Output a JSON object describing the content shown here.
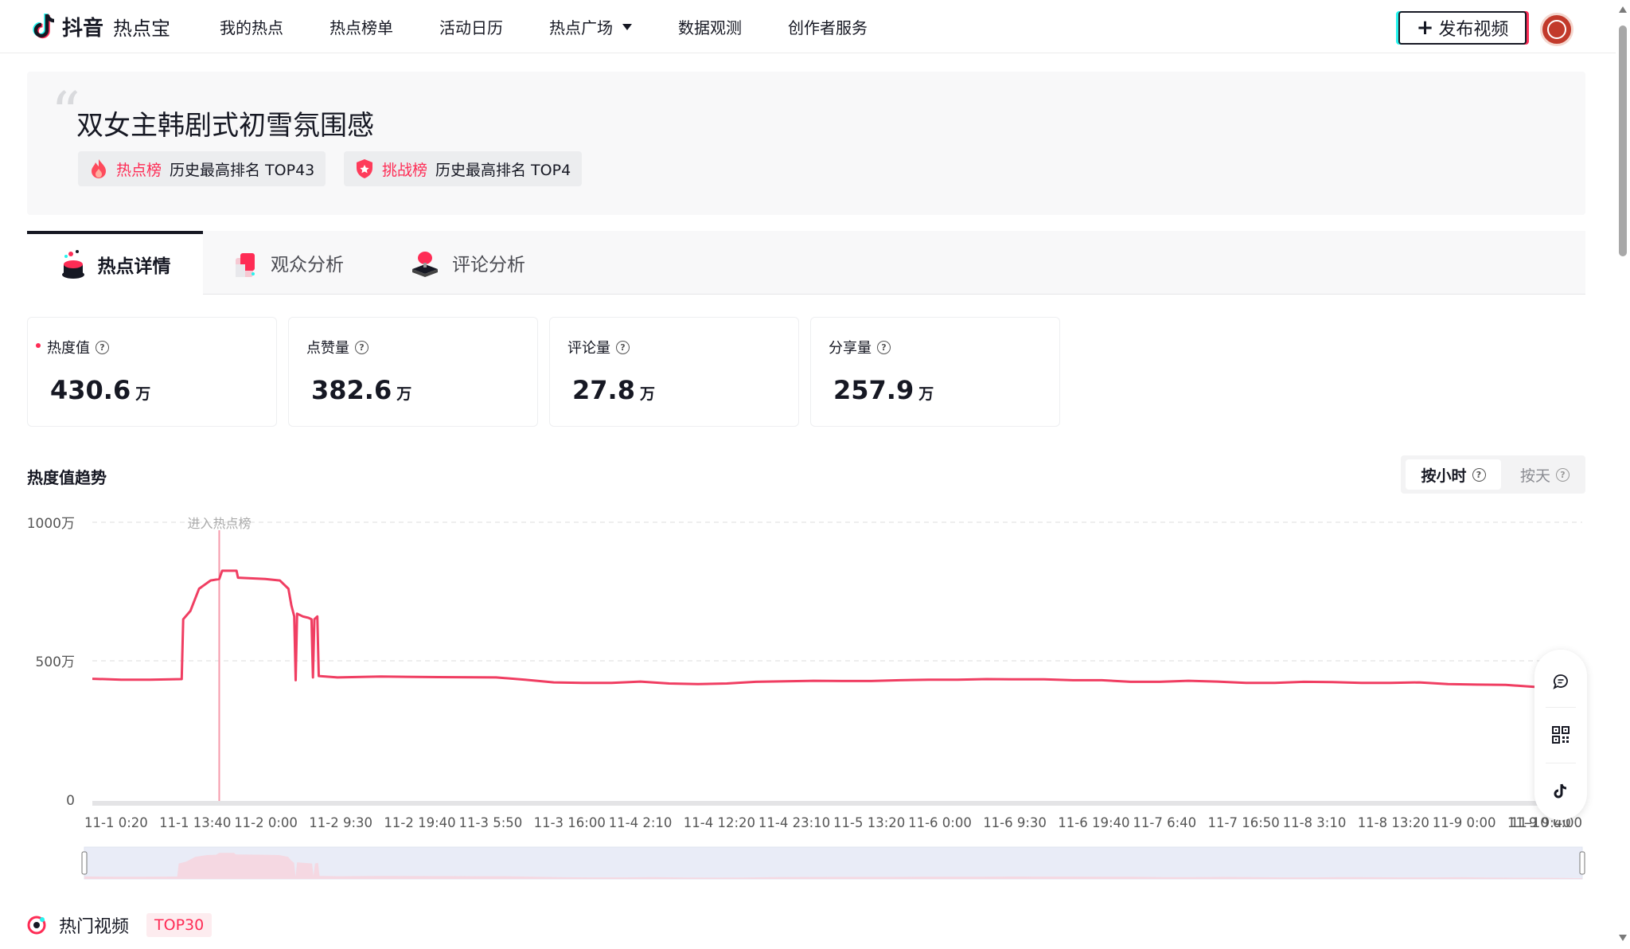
{
  "nav": {
    "logo_word": "抖音",
    "logo_sub": "热点宝",
    "items": [
      "我的热点",
      "热点榜单",
      "活动日历",
      "热点广场",
      "数据观测",
      "创作者服务"
    ],
    "publish_label": "发布视频"
  },
  "hot": {
    "title": "双女主韩剧式初雪氛围感",
    "badges": [
      {
        "name": "热点榜",
        "desc": "历史最高排名 TOP43"
      },
      {
        "name": "挑战榜",
        "desc": "历史最高排名 TOP4"
      }
    ]
  },
  "tabs": [
    "热点详情",
    "观众分析",
    "评论分析"
  ],
  "metrics": [
    {
      "label": "热度值",
      "value": "430.6",
      "unit": "万"
    },
    {
      "label": "点赞量",
      "value": "382.6",
      "unit": "万"
    },
    {
      "label": "评论量",
      "value": "27.8",
      "unit": "万"
    },
    {
      "label": "分享量",
      "value": "257.9",
      "unit": "万"
    }
  ],
  "trend": {
    "title": "热度值趋势",
    "toggle": [
      "按小时",
      "按天"
    ]
  },
  "colors": {
    "accent": "#fe2c55",
    "line": "#f03e62",
    "text": "#161823"
  },
  "chart_data": {
    "type": "line",
    "ylim": [
      0,
      1000
    ],
    "y_ticks": [
      "0",
      "500万",
      "1000万"
    ],
    "y_tick_values": [
      0,
      500,
      1000
    ],
    "x_tick_labels": [
      "11-1 0:20",
      "11-1 13:40",
      "11-2 0:00",
      "11-2 9:30",
      "11-2 19:40",
      "11-3 5:50",
      "11-3 16:00",
      "11-4 2:10",
      "11-4 12:20",
      "11-4 23:10",
      "11-5 13:20",
      "11-6 0:00",
      "11-6 9:30",
      "11-6 19:40",
      "11-7 6:40",
      "11-7 16:50",
      "11-8 3:10",
      "11-8 13:20",
      "11-9 0:00",
      "11-9 9:40",
      "11-10 0:00"
    ],
    "marker": {
      "label": "进入热点榜",
      "x": 0.088
    },
    "x_range": [
      0,
      1
    ],
    "points": [
      [
        0.0,
        435
      ],
      [
        0.02,
        432
      ],
      [
        0.04,
        432
      ],
      [
        0.062,
        434
      ],
      [
        0.063,
        650
      ],
      [
        0.068,
        680
      ],
      [
        0.074,
        760
      ],
      [
        0.082,
        790
      ],
      [
        0.088,
        795
      ],
      [
        0.09,
        825
      ],
      [
        0.1,
        825
      ],
      [
        0.101,
        800
      ],
      [
        0.12,
        795
      ],
      [
        0.13,
        790
      ],
      [
        0.136,
        760
      ],
      [
        0.138,
        700
      ],
      [
        0.14,
        660
      ],
      [
        0.141,
        430
      ],
      [
        0.142,
        670
      ],
      [
        0.146,
        660
      ],
      [
        0.15,
        655
      ],
      [
        0.152,
        650
      ],
      [
        0.153,
        440
      ],
      [
        0.154,
        650
      ],
      [
        0.156,
        660
      ],
      [
        0.157,
        445
      ],
      [
        0.17,
        440
      ],
      [
        0.2,
        443
      ],
      [
        0.24,
        441
      ],
      [
        0.28,
        440
      ],
      [
        0.3,
        432
      ],
      [
        0.32,
        422
      ],
      [
        0.34,
        420
      ],
      [
        0.36,
        420
      ],
      [
        0.38,
        425
      ],
      [
        0.4,
        418
      ],
      [
        0.42,
        416
      ],
      [
        0.44,
        418
      ],
      [
        0.46,
        424
      ],
      [
        0.48,
        426
      ],
      [
        0.5,
        428
      ],
      [
        0.52,
        427
      ],
      [
        0.54,
        427
      ],
      [
        0.56,
        430
      ],
      [
        0.58,
        432
      ],
      [
        0.6,
        432
      ],
      [
        0.62,
        434
      ],
      [
        0.64,
        433
      ],
      [
        0.66,
        433
      ],
      [
        0.68,
        430
      ],
      [
        0.7,
        430
      ],
      [
        0.72,
        424
      ],
      [
        0.74,
        424
      ],
      [
        0.76,
        428
      ],
      [
        0.78,
        425
      ],
      [
        0.8,
        420
      ],
      [
        0.82,
        420
      ],
      [
        0.84,
        424
      ],
      [
        0.86,
        423
      ],
      [
        0.88,
        420
      ],
      [
        0.9,
        420
      ],
      [
        0.92,
        422
      ],
      [
        0.94,
        416
      ],
      [
        0.96,
        414
      ],
      [
        0.98,
        413
      ],
      [
        1.0,
        406
      ]
    ]
  }
}
